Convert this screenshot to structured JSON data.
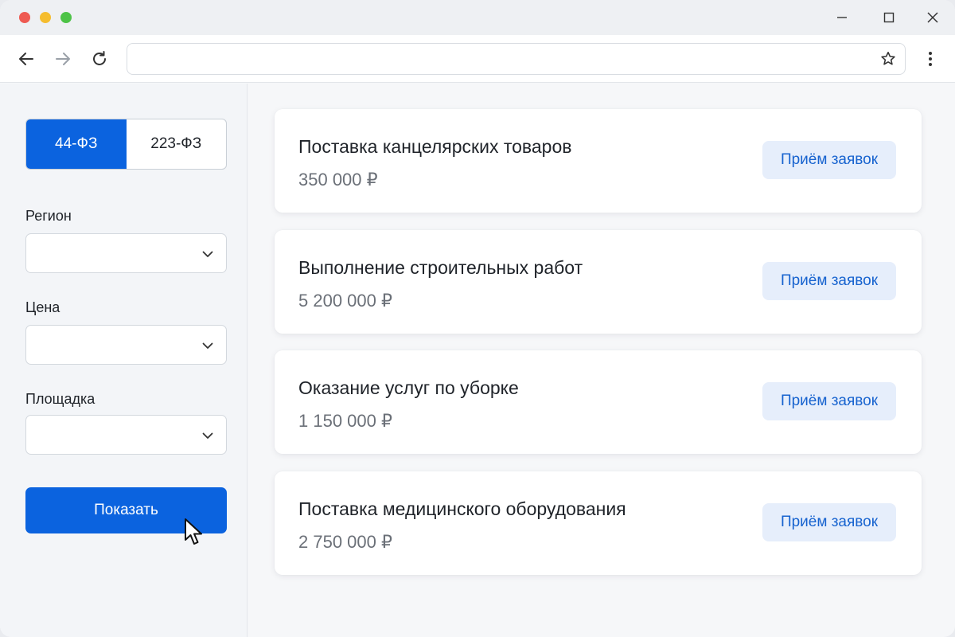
{
  "window": {
    "controls": {
      "minimize": "minimize-icon",
      "maximize": "maximize-icon",
      "close": "close-icon"
    }
  },
  "toolbar": {
    "address_value": "",
    "address_placeholder": ""
  },
  "filters": {
    "law_tabs": [
      {
        "label": "44-ФЗ",
        "selected": true
      },
      {
        "label": "223-ФЗ",
        "selected": false
      }
    ],
    "region": {
      "label": "Регион",
      "value": ""
    },
    "price": {
      "label": "Цена",
      "value": ""
    },
    "platform": {
      "label": "Площадка",
      "value": ""
    },
    "submit_label": "Показать"
  },
  "tenders": [
    {
      "title": "Поставка канцелярских товаров",
      "price": "350 000 ₽",
      "status": "Приём заявок"
    },
    {
      "title": "Выполнение строительных работ",
      "price": "5 200 000 ₽",
      "status": "Приём заявок"
    },
    {
      "title": "Оказание услуг по уборке",
      "price": "1 150 000 ₽",
      "status": "Приём заявок"
    },
    {
      "title": "Поставка медицинского оборудования",
      "price": "2 750 000 ₽",
      "status": "Приём заявок"
    }
  ],
  "colors": {
    "accent": "#0b63df",
    "status_bg": "#e6eefb",
    "status_text": "#1763cf"
  }
}
